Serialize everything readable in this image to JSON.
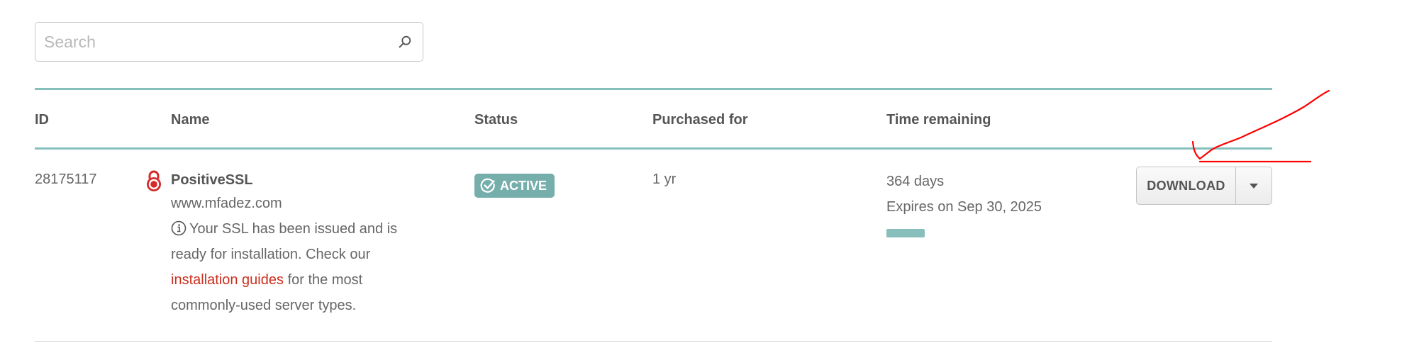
{
  "search": {
    "placeholder": "Search",
    "value": ""
  },
  "table": {
    "columns": {
      "id": "ID",
      "name": "Name",
      "status": "Status",
      "purchased_for": "Purchased for",
      "time_remaining": "Time remaining"
    },
    "rows": [
      {
        "id": "28175117",
        "product": "PositiveSSL",
        "domain": "www.mfadez.com",
        "info_prefix": "Your SSL has been issued and is ready for installation. Check our",
        "info_link": "installation guides",
        "info_suffix": "for the most commonly-used server types.",
        "status": "ACTIVE",
        "purchased_for": "1 yr",
        "days_remaining": "364 days",
        "expires": "Expires on Sep 30, 2025",
        "time_remaining_fraction": 0.997,
        "download_label": "DOWNLOAD"
      }
    ]
  },
  "icons": {
    "search": "search-icon",
    "lock": "lock-icon",
    "info": "info-icon",
    "status": "check-circle-icon",
    "dropdown": "caret-down-icon"
  },
  "colors": {
    "accent_teal": "#86c0bd",
    "badge_bg": "#75aeab",
    "link": "#cc2f1e",
    "lock_red": "#d42a2a",
    "annotation_red": "#ff0000"
  }
}
